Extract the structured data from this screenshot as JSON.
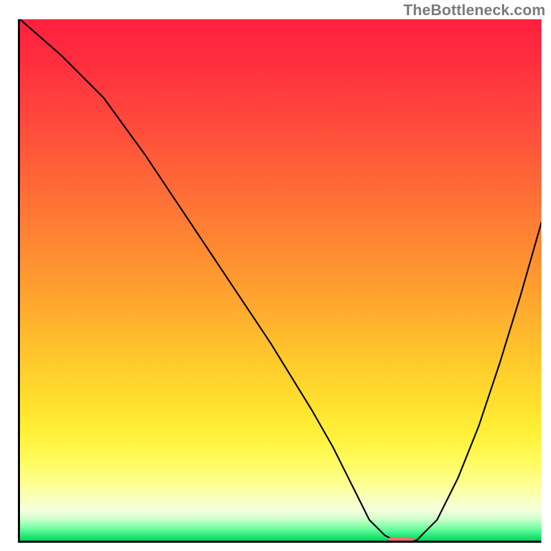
{
  "watermark": "TheBottleneck.com",
  "chart_data": {
    "type": "line",
    "title": "",
    "xlabel": "",
    "ylabel": "",
    "xlim": [
      0,
      100
    ],
    "ylim": [
      0,
      100
    ],
    "grid": false,
    "legend": false,
    "background_gradient": [
      "#ff1f3e",
      "#ff8a32",
      "#ffe12e",
      "#f6ffd6",
      "#0de470"
    ],
    "series": [
      {
        "name": "bottleneck-curve",
        "color": "#000000",
        "x": [
          0,
          8,
          16,
          24,
          32,
          40,
          48,
          56,
          60,
          64,
          67,
          70,
          72,
          76,
          80,
          84,
          88,
          92,
          96,
          100
        ],
        "y": [
          100,
          93,
          85,
          74,
          62,
          50,
          38,
          25,
          18,
          10,
          4,
          1,
          0,
          0,
          4,
          12,
          22,
          34,
          47,
          61
        ]
      }
    ],
    "marker": {
      "name": "optimal-point",
      "color": "#ef6e74",
      "x": 73,
      "y": 0,
      "width_pct": 5,
      "height_pct": 1.4
    }
  }
}
